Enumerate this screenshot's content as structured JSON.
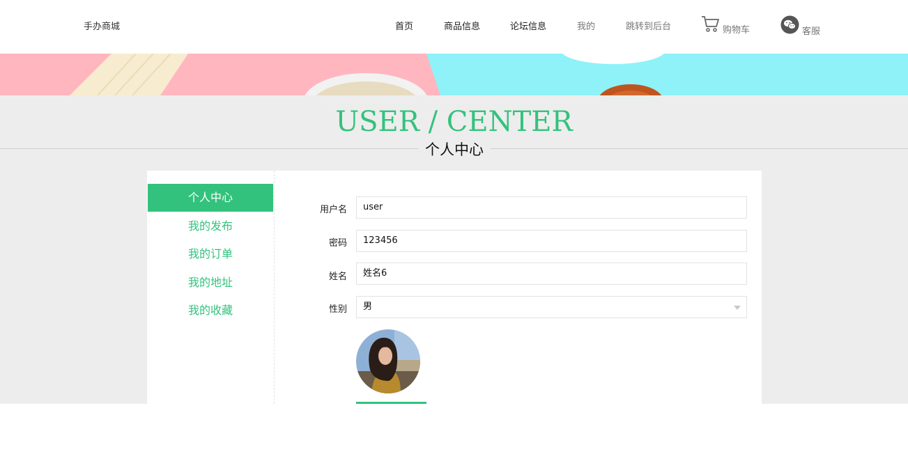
{
  "header": {
    "logo": "手办商城",
    "nav": [
      "首页",
      "商品信息",
      "论坛信息",
      "我的",
      "跳转到后台"
    ],
    "cart_label": "购物车",
    "service_label": "客服"
  },
  "hero": {
    "title_en": "USER / CENTER",
    "title_cn": "个人中心"
  },
  "sidebar": {
    "items": [
      "个人中心",
      "我的发布",
      "我的订单",
      "我的地址",
      "我的收藏"
    ],
    "active_index": 0
  },
  "form": {
    "username_label": "用户名",
    "username_value": "user",
    "password_label": "密码",
    "password_value": "123456",
    "name_label": "姓名",
    "name_value": "姓名6",
    "gender_label": "性别",
    "gender_value": "男"
  },
  "colors": {
    "accent": "#33c27d",
    "background": "#ededed"
  }
}
